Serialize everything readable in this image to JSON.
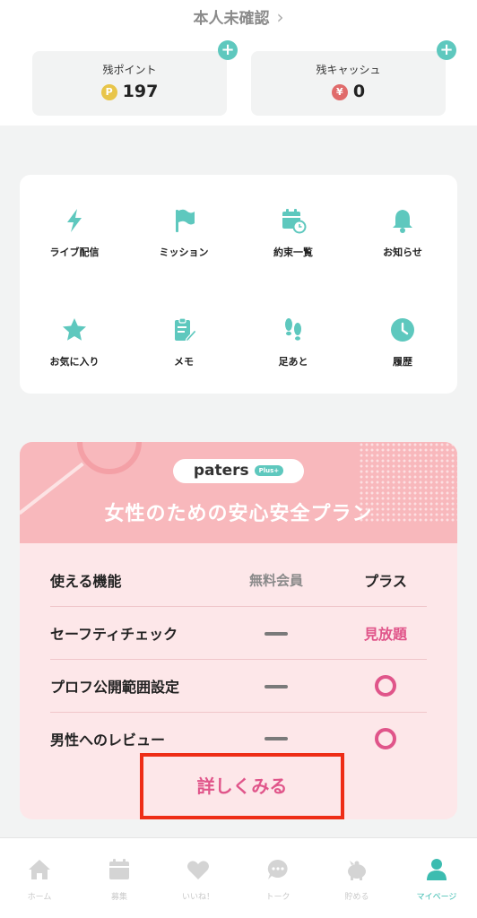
{
  "header": {
    "verify_text": "本人未確認",
    "verify_chevron": "›"
  },
  "balances": {
    "points": {
      "label": "残ポイント",
      "icon_text": "P",
      "value": "197"
    },
    "cash": {
      "label": "残キャッシュ",
      "icon_text": "¥",
      "value": "0"
    },
    "add_symbol": "+"
  },
  "menu": {
    "items": [
      {
        "label": "ライブ配信",
        "icon": "lightning-icon"
      },
      {
        "label": "ミッション",
        "icon": "flag-icon"
      },
      {
        "label": "約束一覧",
        "icon": "calendar-clock-icon"
      },
      {
        "label": "お知らせ",
        "icon": "bell-icon"
      },
      {
        "label": "お気に入り",
        "icon": "star-icon"
      },
      {
        "label": "メモ",
        "icon": "clipboard-pen-icon"
      },
      {
        "label": "足あと",
        "icon": "footprints-icon"
      },
      {
        "label": "履歴",
        "icon": "clock-icon"
      }
    ]
  },
  "plan": {
    "logo": "paters",
    "logo_badge": "Plus+",
    "title": "女性のための安心安全プラン",
    "table": {
      "header": {
        "feature": "使える機能",
        "free": "無料会員",
        "plus": "プラス"
      },
      "rows": [
        {
          "feature": "セーフティチェック",
          "free": "dash",
          "plus": "見放題"
        },
        {
          "feature": "プロフ公開範囲設定",
          "free": "dash",
          "plus": "circle"
        },
        {
          "feature": "男性へのレビュー",
          "free": "dash",
          "plus": "circle"
        }
      ]
    },
    "more_button": "詳しくみる"
  },
  "tabbar": {
    "tabs": [
      {
        "label": "ホーム",
        "icon": "home-icon",
        "active": false
      },
      {
        "label": "募集",
        "icon": "calendar-icon",
        "active": false
      },
      {
        "label": "いいね！",
        "icon": "heart-icon",
        "active": false
      },
      {
        "label": "トーク",
        "icon": "chat-icon",
        "active": false
      },
      {
        "label": "貯める",
        "icon": "piggy-bank-icon",
        "active": false
      },
      {
        "label": "マイページ",
        "icon": "person-icon",
        "active": true
      }
    ]
  },
  "colors": {
    "accent_teal": "#5ec8be",
    "plan_pink": "#f8b8bc",
    "plan_text_pink": "#e0558a",
    "highlight_red": "#ee2d16"
  }
}
